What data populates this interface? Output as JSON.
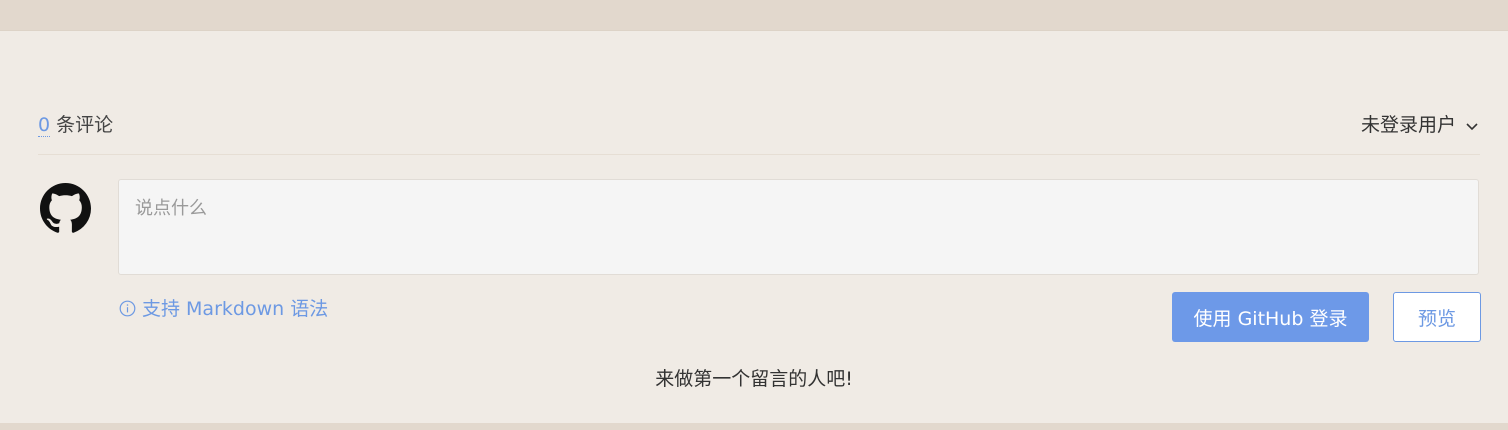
{
  "comments": {
    "count": "0",
    "count_suffix": "条评论"
  },
  "user_menu": {
    "label": "未登录用户",
    "icon": "chevron-down-icon"
  },
  "editor": {
    "avatar_icon": "github-icon",
    "placeholder": "说点什么",
    "value": ""
  },
  "markdown_tip": {
    "icon": "info-icon",
    "label": "支持 Markdown 语法"
  },
  "buttons": {
    "login_label": "使用 GitHub 登录",
    "preview_label": "预览"
  },
  "empty_message": "来做第一个留言的人吧!",
  "colors": {
    "background": "#f0ebe5",
    "band": "#e2d8cd",
    "accent": "#6d99e8",
    "textarea_bg": "#f5f5f5"
  }
}
